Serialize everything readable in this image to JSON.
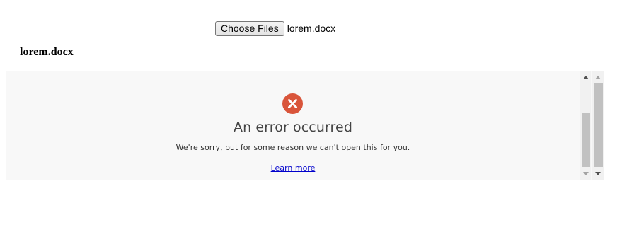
{
  "file_input": {
    "button_label": "Choose Files",
    "selected_file": "lorem.docx"
  },
  "document": {
    "title": "lorem.docx"
  },
  "viewer": {
    "error": {
      "icon": "error-x-circle-icon",
      "heading": "An error occurred",
      "message": "We're sorry, but for some reason we can't open this for you.",
      "link_label": "Learn more"
    }
  },
  "colors": {
    "error_icon": "#d9553b",
    "viewer_background": "#f8f8f8",
    "link": "#0000cc",
    "heading_text": "#444444"
  }
}
